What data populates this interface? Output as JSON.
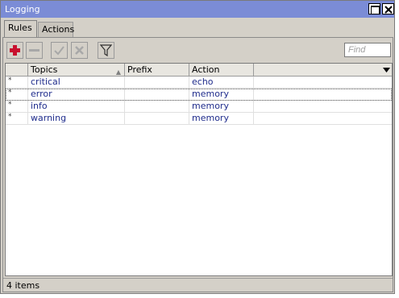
{
  "window": {
    "title": "Logging"
  },
  "tabs": [
    {
      "label": "Rules",
      "active": true
    },
    {
      "label": "Actions",
      "active": false
    }
  ],
  "toolbar": {
    "add_icon": "plus-icon",
    "remove_icon": "minus-icon",
    "enable_icon": "check-icon",
    "disable_icon": "x-icon",
    "filter_icon": "filter-icon",
    "find_placeholder": "Find"
  },
  "table": {
    "columns": [
      "",
      "Topics",
      "Prefix",
      "Action"
    ],
    "sorted_column": "Topics",
    "rows": [
      {
        "flag": "*",
        "topics": "critical",
        "prefix": "",
        "action": "echo"
      },
      {
        "flag": "*",
        "topics": "error",
        "prefix": "",
        "action": "memory"
      },
      {
        "flag": "*",
        "topics": "info",
        "prefix": "",
        "action": "memory"
      },
      {
        "flag": "*",
        "topics": "warning",
        "prefix": "",
        "action": "memory"
      }
    ]
  },
  "status": {
    "text": "4 items"
  },
  "colors": {
    "titlebar": "#7b8cd6",
    "window_bg": "#d4d0c8",
    "cell_text": "#1f2c8c",
    "add_red": "#c8102e"
  }
}
